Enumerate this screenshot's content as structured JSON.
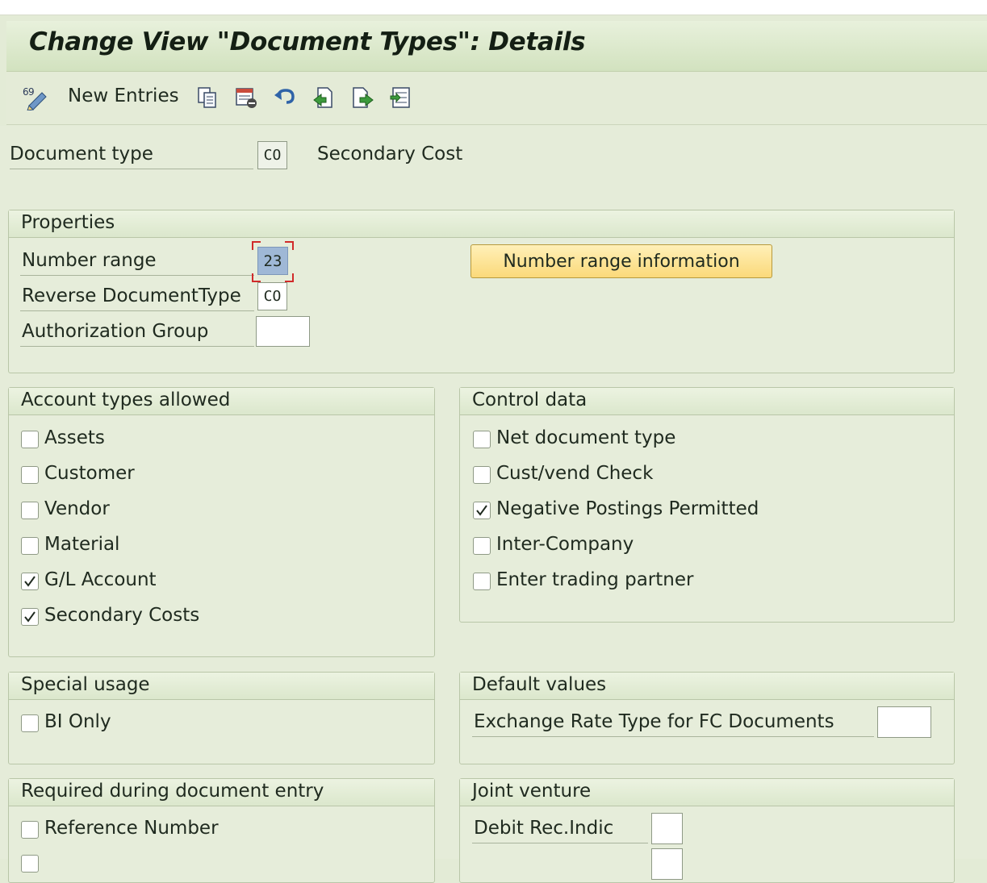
{
  "header": {
    "title": "Change View \"Document Types\": Details"
  },
  "toolbar": {
    "new_entries_label": "New Entries",
    "icons": [
      "display-change-icon",
      "copy-icon",
      "delete-icon",
      "undo-icon",
      "previous-entry-icon",
      "next-entry-icon",
      "select-all-icon"
    ]
  },
  "document_type": {
    "label": "Document type",
    "value": "CO",
    "description": "Secondary Cost"
  },
  "properties": {
    "title": "Properties",
    "number_range": {
      "label": "Number range",
      "value": "23"
    },
    "reverse_doc_type": {
      "label": "Reverse DocumentType",
      "value": "CO"
    },
    "authorization_group": {
      "label": "Authorization Group",
      "value": ""
    },
    "number_range_info_button": "Number range information"
  },
  "account_types": {
    "title": "Account types allowed",
    "items": [
      {
        "label": "Assets",
        "checked": false
      },
      {
        "label": "Customer",
        "checked": false
      },
      {
        "label": "Vendor",
        "checked": false
      },
      {
        "label": "Material",
        "checked": false
      },
      {
        "label": "G/L Account",
        "checked": true
      },
      {
        "label": "Secondary Costs",
        "checked": true
      }
    ]
  },
  "control_data": {
    "title": "Control data",
    "items": [
      {
        "label": "Net document type",
        "checked": false
      },
      {
        "label": "Cust/vend Check",
        "checked": false
      },
      {
        "label": "Negative Postings Permitted",
        "checked": true
      },
      {
        "label": "Inter-Company",
        "checked": false
      },
      {
        "label": "Enter trading partner",
        "checked": false
      }
    ]
  },
  "special_usage": {
    "title": "Special usage",
    "items": [
      {
        "label": "BI Only",
        "checked": false
      }
    ]
  },
  "default_values": {
    "title": "Default values",
    "exchange_rate": {
      "label": "Exchange Rate Type for FC Documents",
      "value": ""
    }
  },
  "required_entry": {
    "title": "Required during document entry",
    "items": [
      {
        "label": "Reference Number",
        "checked": false
      }
    ]
  },
  "joint_venture": {
    "title": "Joint venture",
    "debit_rec_indic": {
      "label": "Debit Rec.Indic",
      "value": ""
    }
  },
  "colors": {
    "background": "#e5ecd9",
    "button_accent": "#fbd97a",
    "selected_field": "#9fb8d6",
    "focus_red": "#d12a2a"
  }
}
